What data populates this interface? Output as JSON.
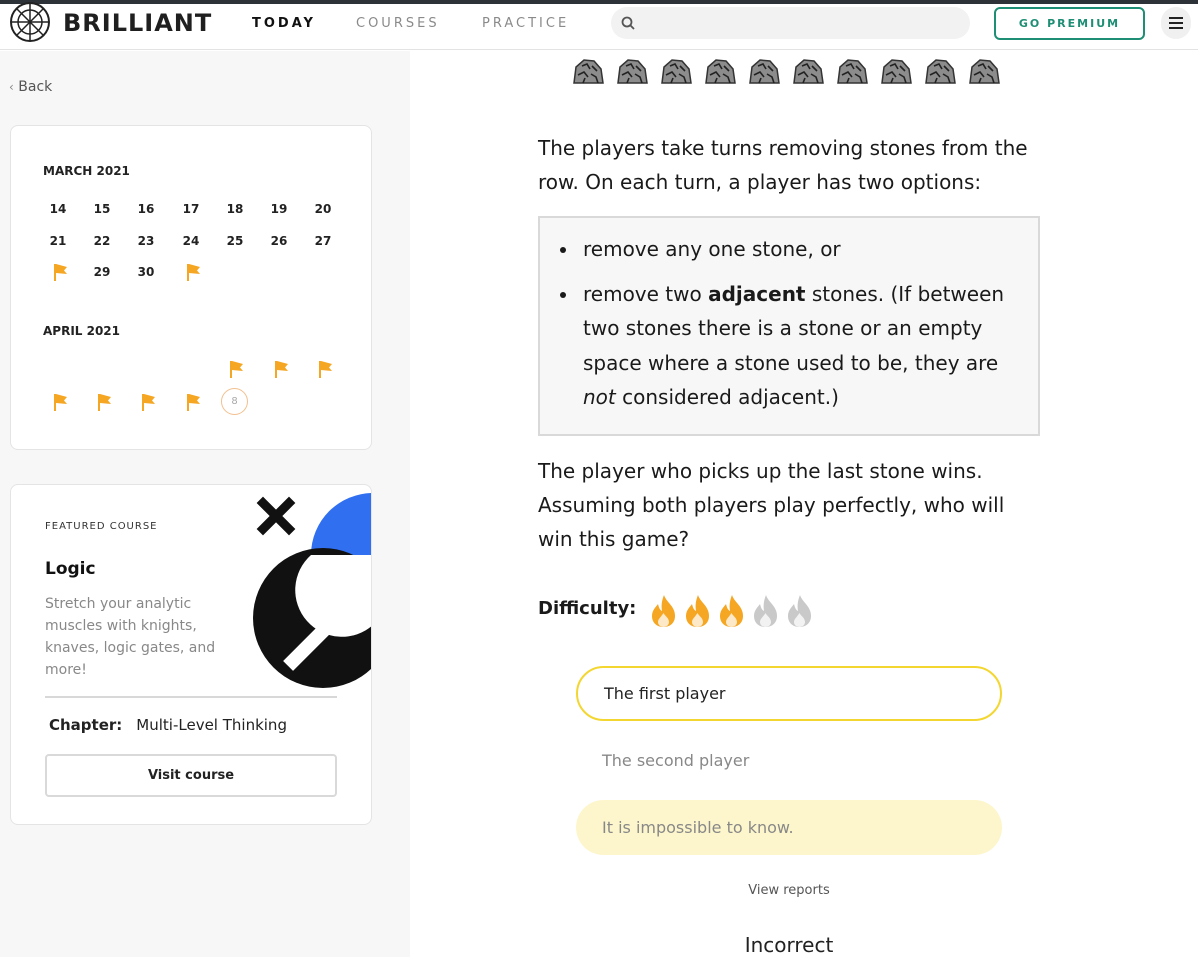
{
  "brand": {
    "name": "BRILLIANT"
  },
  "nav": {
    "items": [
      {
        "label": "TODAY",
        "active": true
      },
      {
        "label": "COURSES",
        "active": false
      },
      {
        "label": "PRACTICE",
        "active": false
      }
    ],
    "premium_label": "GO PREMIUM"
  },
  "sidebar": {
    "back_label": "Back",
    "calendar": {
      "months": [
        {
          "label": "MARCH 2021",
          "row1": [
            "14",
            "15",
            "16",
            "17",
            "18",
            "19",
            "20"
          ],
          "row2": [
            "21",
            "22",
            "23",
            "24",
            "25",
            "26",
            "27"
          ],
          "row3": [
            "29",
            "30"
          ]
        },
        {
          "label": "APRIL 2021",
          "today": "8"
        }
      ]
    },
    "featured": {
      "label": "FEATURED COURSE",
      "title": "Logic",
      "description": "Stretch your analytic muscles with knights, knaves, logic gates, and more!",
      "chapter_label": "Chapter:",
      "chapter_value": "Multi-Level Thinking",
      "visit_label": "Visit course"
    }
  },
  "problem": {
    "stone_count": 10,
    "intro": "The players take turns removing stones from the row. On each turn, a player has two options:",
    "rule1": "remove any one stone, or",
    "rule2_before": "remove two ",
    "rule2_bold": "adjacent",
    "rule2_middle": " stones. (If between two stones there is a stone or an empty space where a stone used to be, they are ",
    "rule2_italic": "not",
    "rule2_after": " considered adjacent.)",
    "question": "The player who picks up the last stone wins. Assuming both players play perfectly, who will win this game?",
    "difficulty_label": "Difficulty:",
    "difficulty_level": 3,
    "difficulty_max": 5,
    "options": [
      "The first player",
      "The second player",
      "It is impossible to know."
    ],
    "view_reports": "View reports",
    "result": "Incorrect"
  },
  "colors": {
    "premium": "#1e8e74",
    "flag": "#f5a623",
    "selected_border": "#f3d630",
    "highlight_bg": "#fdf6cc",
    "flame_on": "#f5a623",
    "flame_off": "#c9c9c9"
  }
}
